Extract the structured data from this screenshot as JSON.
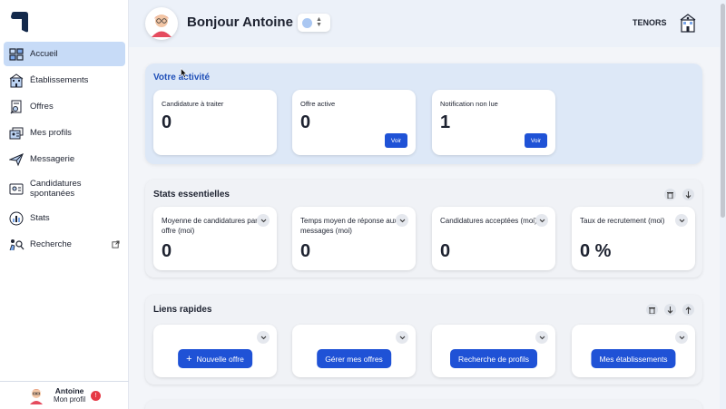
{
  "colors": {
    "accent": "#1f52d6",
    "active_nav": "#c7dbf7",
    "activity_title": "#1f4fb8",
    "badge": "#e53945"
  },
  "sidebar": {
    "items": [
      {
        "label": "Accueil",
        "icon": "home-grid-icon",
        "active": true
      },
      {
        "label": "Établissements",
        "icon": "buildings-icon"
      },
      {
        "label": "Offres",
        "icon": "document-search-icon"
      },
      {
        "label": "Mes profils",
        "icon": "profiles-icon"
      },
      {
        "label": "Messagerie",
        "icon": "paper-plane-icon"
      },
      {
        "label": "Candidatures spontanées",
        "icon": "id-card-icon"
      },
      {
        "label": "Stats",
        "icon": "stats-chart-icon"
      },
      {
        "label": "Recherche",
        "icon": "search-people-icon",
        "external": true
      }
    ],
    "profile": {
      "name": "Antoine",
      "subtitle": "Mon profil",
      "badge": "!"
    }
  },
  "header": {
    "greeting": "Bonjour Antoine",
    "company": "TENORS"
  },
  "activity": {
    "title": "Votre activité",
    "cards": [
      {
        "label": "Candidature à traiter",
        "value": "0"
      },
      {
        "label": "Offre active",
        "value": "0",
        "button": "Voir"
      },
      {
        "label": "Notification non lue",
        "value": "1",
        "button": "Voir"
      }
    ]
  },
  "stats": {
    "title": "Stats essentielles",
    "cards": [
      {
        "label": "Moyenne de candidatures par offre (moi)",
        "value": "0"
      },
      {
        "label": "Temps moyen de réponse aux messages (moi)",
        "value": "0"
      },
      {
        "label": "Candidatures acceptées (moi)",
        "value": "0"
      },
      {
        "label": "Taux de recrutement (moi)",
        "value": "0 %"
      }
    ]
  },
  "links": {
    "title": "Liens rapides",
    "cards": [
      {
        "action": "Nouvelle offre",
        "plus": "+"
      },
      {
        "action": "Gérer mes offres"
      },
      {
        "action": "Recherche de profils"
      },
      {
        "action": "Mes établissements"
      }
    ]
  }
}
